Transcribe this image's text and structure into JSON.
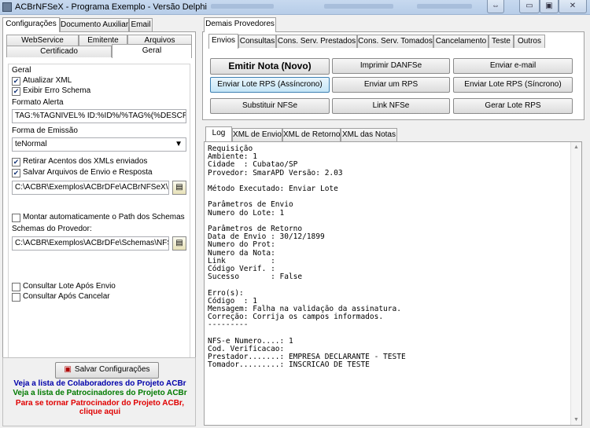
{
  "window": {
    "title": "ACBrNFSeX - Programa Exemplo - Versão Delphi",
    "controls": [
      "⇔",
      "▭",
      "▣",
      "✕"
    ]
  },
  "left": {
    "tabs": [
      "Configurações",
      "Documento Auxiliar",
      "Email"
    ],
    "subtabs_row1": [
      "WebService",
      "Emitente",
      "Arquivos"
    ],
    "subtabs_row2": [
      "Certificado",
      "Geral"
    ],
    "group_title": "Geral",
    "atualizar_xml": "Atualizar XML",
    "exibir_erro": "Exibir Erro Schema",
    "formato_alerta_label": "Formato Alerta",
    "formato_alerta_value": "TAG:%TAGNIVEL% ID:%ID%/%TAG%(%DESCRI",
    "forma_emissao_label": "Forma de Emissão",
    "forma_emissao_value": "teNormal",
    "retirar_acentos": "Retirar Acentos dos XMLs enviados",
    "salvar_arquivos": "Salvar Arquivos de Envio e Resposta",
    "path_arquivos": "C:\\ACBR\\Exemplos\\ACBrDFe\\ACBrNFSeX\\Delp",
    "montar_path": "Montar automaticamente o Path dos Schemas",
    "schemas_label": "Schemas do Provedor:",
    "path_schemas": "C:\\ACBR\\Exemplos\\ACBrDFe\\Schemas\\NFSe\\S",
    "consultar_lote": "Consultar Lote Após Envio",
    "consultar_apos": "Consultar Após Cancelar",
    "salvar_button": "Salvar Configurações",
    "link_colaboradores": "Veja a lista de Colaboradores do Projeto ACBr",
    "link_patrocinadores": "Veja a lista de Patrocinadores do Projeto ACBr",
    "link_tornar_1": "Para se tornar Patrocinador do Projeto ACBr,",
    "link_tornar_2": "clique aqui"
  },
  "right": {
    "outer_tab": "Demais Provedores",
    "tabs": [
      "Envios",
      "Consultas",
      "Cons. Serv. Prestados",
      "Cons. Serv. Tomados",
      "Cancelamento",
      "Teste",
      "Outros"
    ],
    "buttons": {
      "emitir": "Emitir Nota (Novo)",
      "imprimir": "Imprimir DANFSe",
      "email": "Enviar e-mail",
      "lote_async": "Enviar Lote RPS (Assíncrono)",
      "enviar_rps": "Enviar um RPS",
      "lote_sync": "Enviar Lote RPS (Síncrono)",
      "substituir": "Substituir NFSe",
      "link": "Link NFSe",
      "gerar": "Gerar Lote RPS"
    },
    "log_tabs": [
      "Log",
      "XML de Envio",
      "XML de Retorno",
      "XML das Notas"
    ],
    "log_text": "Requisição\nAmbiente: 1\nCidade  : Cubatao/SP\nProvedor: SmarAPD Versão: 2.03\n\nMétodo Executado: Enviar Lote\n\nParâmetros de Envio\nNumero do Lote: 1\n\nParâmetros de Retorno\nData de Envio : 30/12/1899\nNumero do Prot:\nNumero da Nota:\nLink          :\nCódigo Verif. :\nSucesso       : False\n\nErro(s):\nCódigo  : 1\nMensagem: Falha na validação da assinatura.\nCorreção: Corrija os campos informados.\n---------\n\nNFS-e Numero....: 1\nCod. Verificacao:\nPrestador.......: EMPRESA DECLARANTE - TESTE\nTomador.........: INSCRICAO DE TESTE"
  },
  "colors": {
    "link_blue": "#0000aa",
    "link_green": "#007a00",
    "link_red": "#e00000"
  }
}
